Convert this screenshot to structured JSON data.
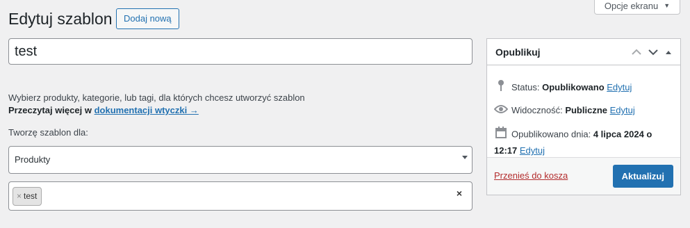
{
  "header": {
    "screen_options_label": "Opcje ekranu",
    "page_title": "Edytuj szablon",
    "add_new_label": "Dodaj nową"
  },
  "editor": {
    "title_value": "test",
    "description_line1": "Wybierz produkty, kategorie, lub tagi, dla których chcesz utworzyć szablon",
    "read_more_prefix": "Przeczytaj więcej w ",
    "read_more_link": "dokumentacji wtyczki →",
    "for_label": "Tworzę szablon dla:",
    "select_value": "Produkty",
    "tags": [
      "test"
    ],
    "tag_remove_glyph": "×",
    "clear_glyph": "×"
  },
  "publish": {
    "title": "Opublikuj",
    "status_label": "Status: ",
    "status_value": "Opublikowano",
    "status_edit": "Edytuj",
    "visibility_label": "Widoczność: ",
    "visibility_value": "Publiczne",
    "visibility_edit": "Edytuj",
    "published_label": "Opublikowano dnia: ",
    "published_value_line1": "4 lipca 2024 o",
    "published_value_line2": "12:17",
    "published_edit": "Edytuj",
    "trash_label": "Przenieś do kosza",
    "update_label": "Aktualizuj"
  },
  "colors": {
    "accent": "#2271b1",
    "danger": "#b32d2e",
    "background": "#f0f0f1"
  }
}
